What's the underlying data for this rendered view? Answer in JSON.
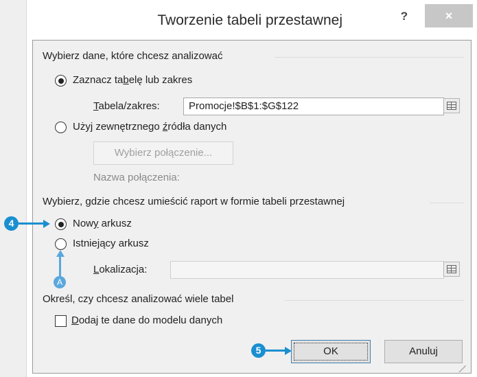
{
  "dialog": {
    "title": "Tworzenie tabeli przestawnej",
    "help_label": "?",
    "close_label": "×"
  },
  "section_data": {
    "label": "Wybierz dane, które chcesz analizować",
    "option_table": {
      "pre": "Zaznacz ta",
      "accel": "b",
      "post": "elę lub zakres",
      "selected": true
    },
    "table_range": {
      "label_accel": "T",
      "label_rest": "abela/zakres:",
      "value": "Promocje!$B$1:$G$122"
    },
    "option_external": {
      "pre": "Użyj zewnętrznego ",
      "accel": "ź",
      "post": "ródła danych",
      "selected": false
    },
    "choose_connection_label": "Wybierz połączenie...",
    "connection_name_label": "Nazwa połączenia:"
  },
  "section_location": {
    "label": "Wybierz, gdzie chcesz umieścić raport w formie tabeli przestawnej",
    "option_new": {
      "pre": "Now",
      "accel": "y",
      "post": " arkusz",
      "selected": true
    },
    "option_existing": {
      "pre": "Istnie",
      "accel": "j",
      "post": "ący arkusz",
      "selected": false
    },
    "location": {
      "label_accel": "L",
      "label_rest": "okalizacja:",
      "value": ""
    }
  },
  "section_multi": {
    "label": "Określ, czy chcesz analizować wiele tabel",
    "checkbox": {
      "accel": "D",
      "rest": "odaj te dane do modelu danych",
      "checked": false
    }
  },
  "buttons": {
    "ok_label": "OK",
    "cancel_label": "Anuluj"
  },
  "callouts": {
    "step4": "4",
    "step5": "5",
    "a": "A"
  },
  "colors": {
    "callout": "#1a8fd0",
    "callout_light": "#5aa7dd",
    "close_button": "#c7c7c7"
  }
}
